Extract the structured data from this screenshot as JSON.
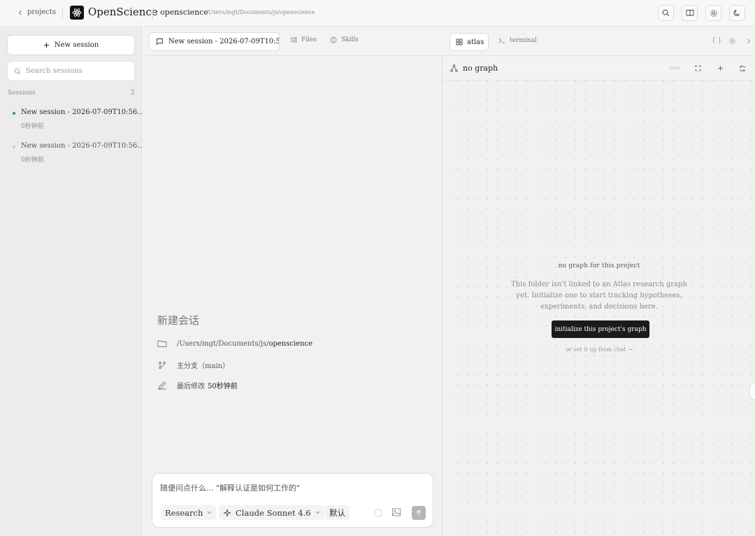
{
  "topbar": {
    "back_label": "projects",
    "brand": "OpenScience",
    "project_name": "openscience",
    "project_path": "/Users/mgt/Documents/js/openscience"
  },
  "sidebar": {
    "new_session_label": "New session",
    "search_placeholder": "Search sessions",
    "sessions_label": "Sessions",
    "sessions_count": "2",
    "sessions": [
      {
        "title": "New session - 2026-07-09T10:56...",
        "time": "0秒钟前",
        "active": true
      },
      {
        "title": "New session - 2026-07-09T10:56...",
        "time": "0秒钟前",
        "active": false
      }
    ]
  },
  "middle": {
    "tab_active": "New session - 2026-07-09T10:5...",
    "tab_files": "Files",
    "tab_skills": "Skills",
    "title": "新建会话",
    "path_prefix": "/Users/mgt/Documents/js/",
    "path_last": "openscience",
    "branch": "主分支（main）",
    "modified_label": "最后修改",
    "modified_value": "50秒钟前",
    "composer": {
      "placeholder": "随便问点什么... \"解释认证是如何工作的\"",
      "mode": "Research",
      "model": "Claude Sonnet 4.6",
      "default": "默认"
    }
  },
  "right": {
    "tab_atlas": "atlas",
    "tab_terminal": "terminal",
    "braces": "{ }",
    "header_title": "no graph",
    "reset_label": "reset",
    "empty_title": "no graph for this project",
    "empty_desc": "This folder isn't linked to an Atlas research graph yet. Initialize one to start tracking hypotheses, experiments, and decisions here.",
    "init_button": "initialize this project's graph",
    "chat_link": "or set it up from chat →"
  },
  "colors": {
    "accent_dot": "#3f8f6a",
    "button_dark": "#1b1b1b"
  }
}
